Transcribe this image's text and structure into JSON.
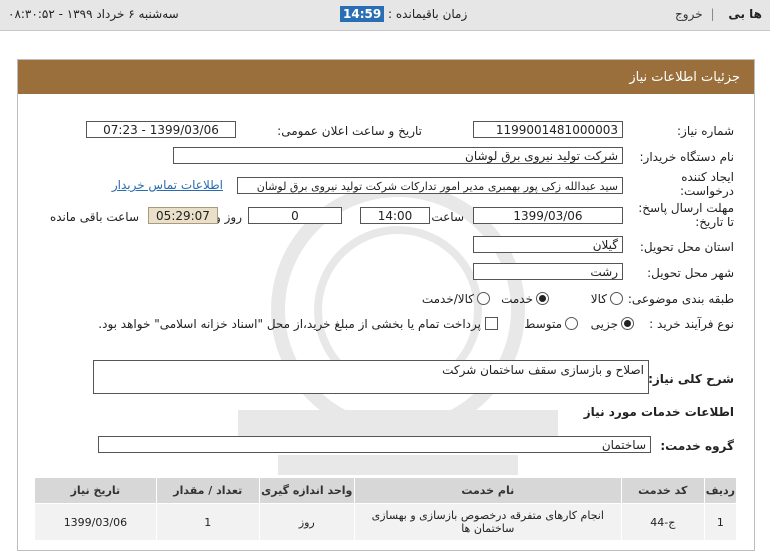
{
  "topbar": {
    "brand": "ها بی",
    "exit_label": "خروج",
    "remaining_label": "زمان باقیمانده :",
    "remaining_time": "14:59",
    "datetime": "سه‌شنبه ۶ خرداد ۱۳۹۹ - ۰۸:۳۰:۵۲"
  },
  "panel": {
    "title": "جزئیات اطلاعات نیاز"
  },
  "form": {
    "need_number_label": "شماره نیاز:",
    "need_number": "1199001481000003",
    "announce_label": "تاریخ و ساعت اعلان عمومی:",
    "announce_value": "1399/03/06 - 07:23",
    "buyer_label": "نام دستگاه خریدار:",
    "buyer_value": "شرکت تولید نیروی برق لوشان",
    "creator_label_1": "ایجاد کننده",
    "creator_label_2": "درخواست:",
    "creator_value": "سید عبدالله زکی پور بهمبری مدیر امور تدارکات شرکت تولید نیروی برق لوشان",
    "contact_link": "اطلاعات تماس خریدار",
    "deadline_label_1": "مهلت ارسال پاسخ:",
    "deadline_label_2": "تا تاریخ:",
    "deadline_date": "1399/03/06",
    "time_label": "ساعت",
    "deadline_time": "14:00",
    "days_value": "0",
    "days_label": "روز و",
    "remaining_value": "05:29:07",
    "remaining_label": "ساعت باقی مانده",
    "province_label": "استان محل تحویل:",
    "province_value": "گیلان",
    "city_label": "شهر محل تحویل:",
    "city_value": "رشت",
    "category_label": "طبقه بندی موضوعی:",
    "category_options": [
      "کالا",
      "خدمت",
      "کالا/خدمت"
    ],
    "category_selected": "خدمت",
    "process_label": "نوع فرآیند خرید :",
    "process_options": [
      "جزیی",
      "متوسط"
    ],
    "process_selected": "جزیی",
    "payment_note": "پرداخت تمام یا بخشی از مبلغ خرید،از محل \"اسناد خزانه اسلامی\" خواهد بود."
  },
  "description": {
    "label": "شرح کلی نیاز:",
    "value": "اصلاح و بازسازی سقف ساختمان شرکت"
  },
  "services": {
    "section_title": "اطلاعات خدمات مورد نیاز",
    "group_label": "گروه خدمت:",
    "group_value": "ساختمان",
    "columns": [
      "ردیف",
      "کد خدمت",
      "نام خدمت",
      "واحد اندازه گیری",
      "تعداد / مقدار",
      "تاریخ نیاز"
    ],
    "rows": [
      [
        "1",
        "ج-44",
        "انجام کارهای متفرقه درخصوص بازسازی و بهسازی ساختمان ها",
        "روز",
        "1",
        "1399/03/06"
      ]
    ]
  },
  "colors": {
    "header_bg": "#9b6f3c",
    "timer_bg": "#2a6fb3",
    "link": "#2b6cb0"
  }
}
